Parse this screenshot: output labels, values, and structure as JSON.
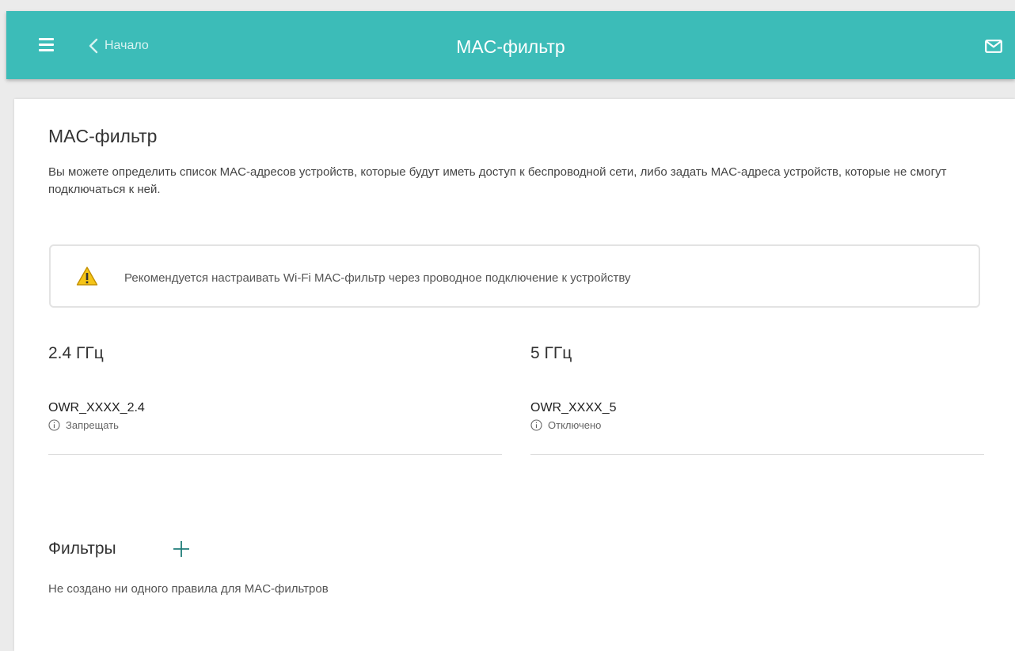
{
  "header": {
    "back_label": "Начало",
    "title": "MAC-фильтр",
    "icons": {
      "menu": "hamburger-menu-icon",
      "back": "chevron-left-icon",
      "mail": "mail-envelope-icon"
    }
  },
  "page": {
    "title": "MAC-фильтр",
    "description": "Вы можете определить список MAC-адресов устройств, которые будут иметь доступ к беспроводной сети, либо задать MAC-адреса устройств, которые не смогут подключаться к ней."
  },
  "warning": {
    "text": "Рекомендуется настраивать Wi-Fi MAC-фильтр через проводное подключение к устройству",
    "icon": "warning-triangle-icon"
  },
  "bands": [
    {
      "title": "2.4 ГГц",
      "network": "OWR_XXXX_2.4",
      "status": "Запрещать"
    },
    {
      "title": "5 ГГц",
      "network": "OWR_XXXX_5",
      "status": "Отключено"
    }
  ],
  "filters": {
    "title": "Фильтры",
    "empty_text": "Не создано ни одного правила для MAC-фильтров"
  },
  "colors": {
    "header_bg": "#3cbcb8",
    "add_icon": "#1f7d79",
    "warning_fill": "#f5c518"
  }
}
